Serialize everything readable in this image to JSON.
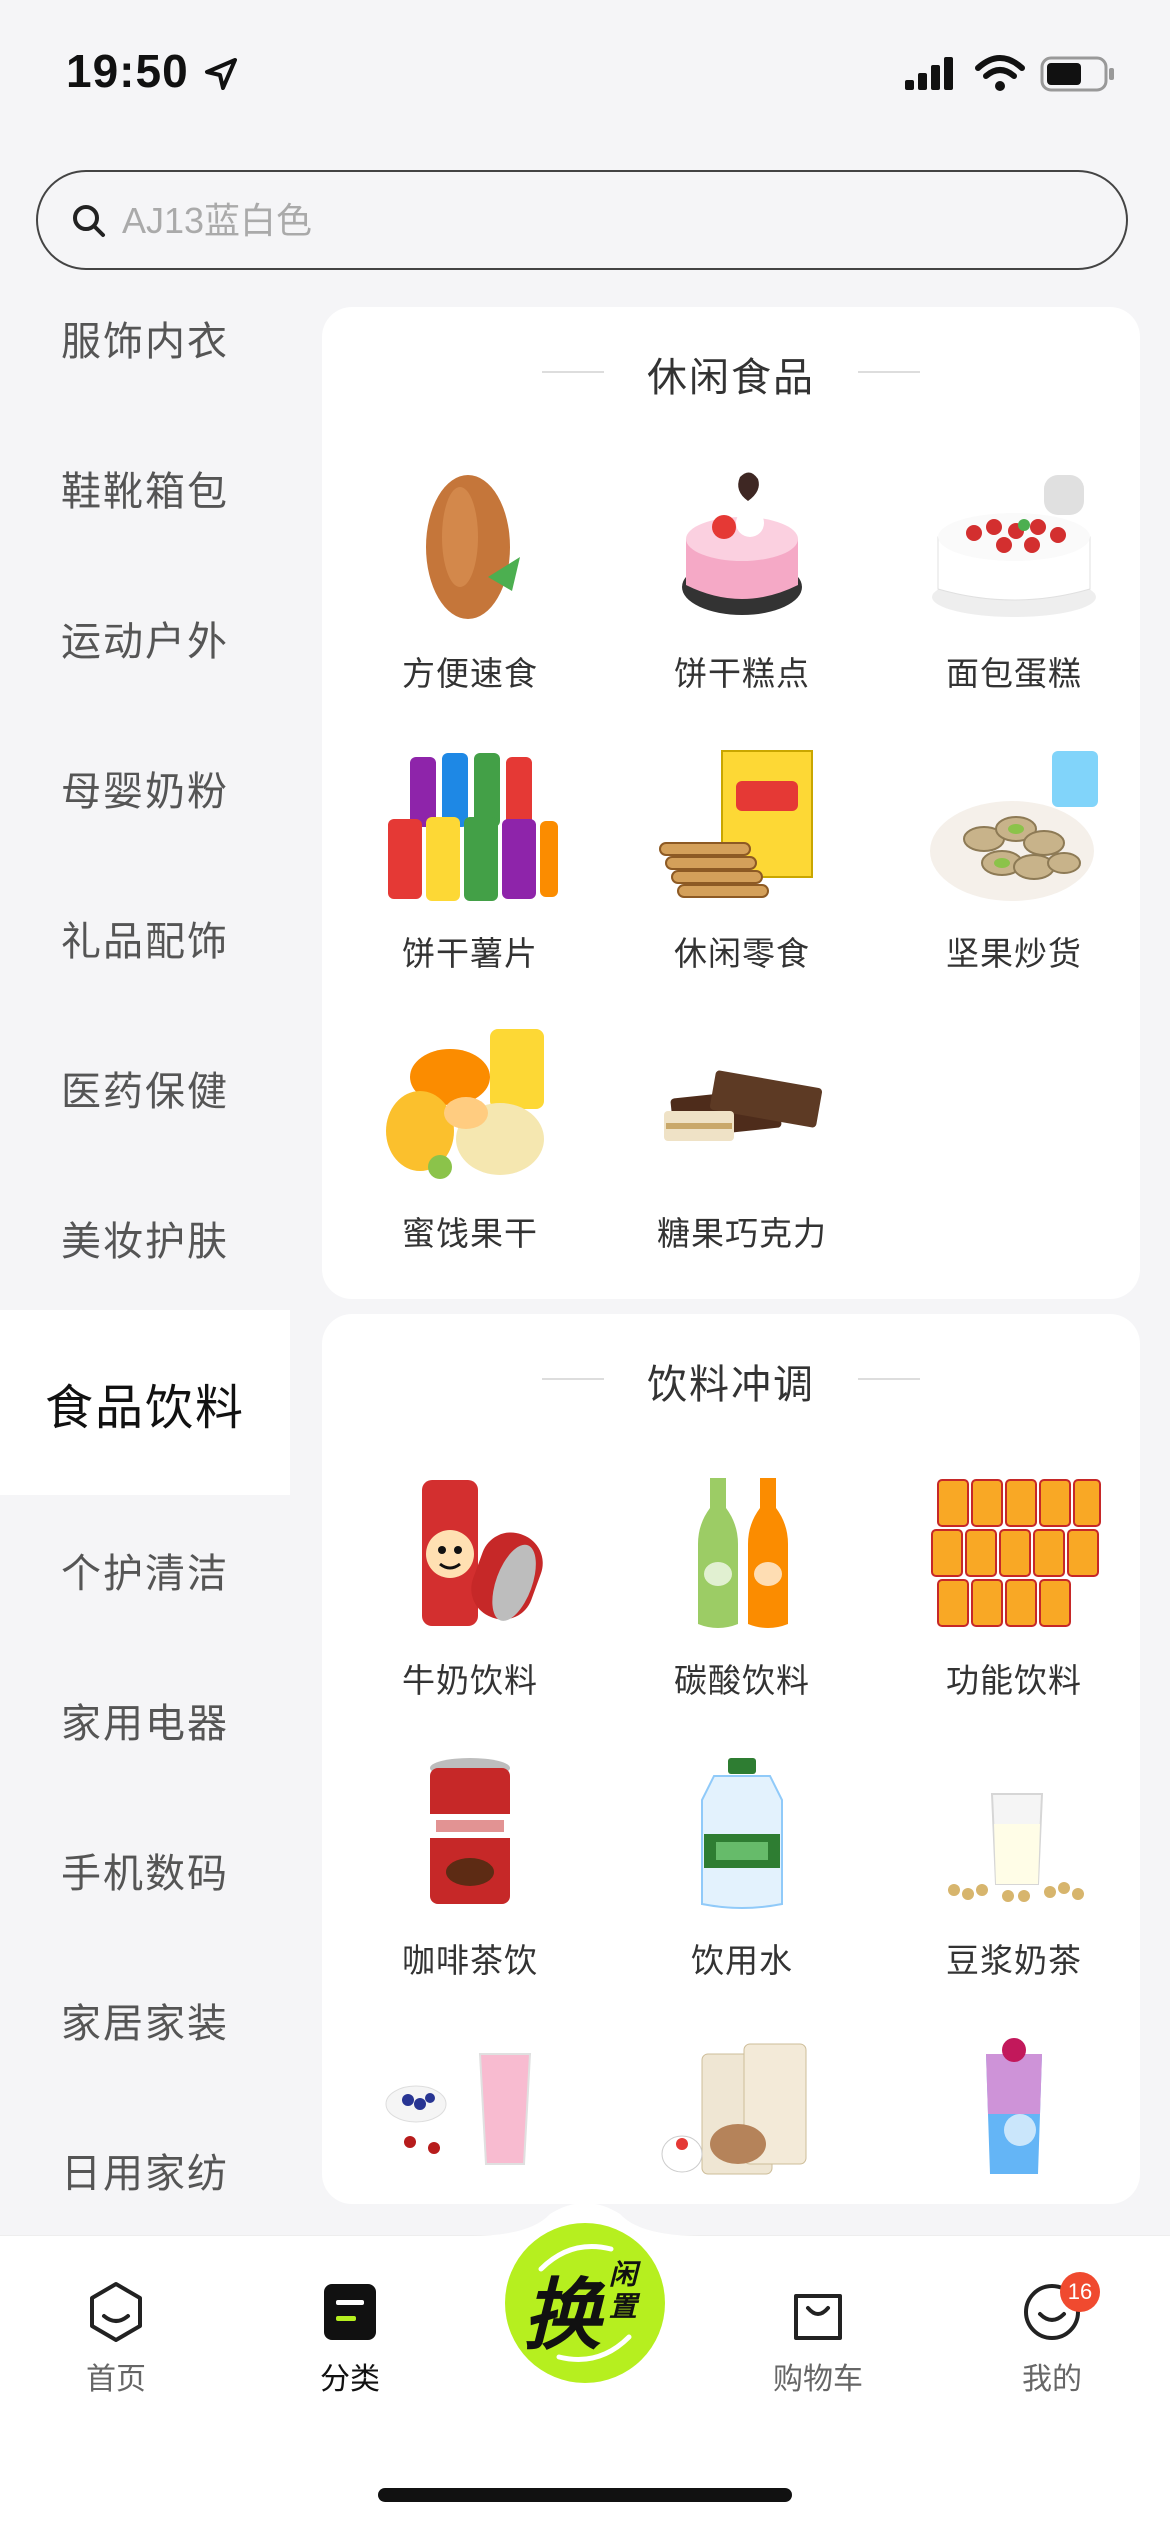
{
  "status_bar": {
    "time": "19:50"
  },
  "search": {
    "placeholder": "AJ13蓝白色"
  },
  "sidebar": {
    "items": [
      {
        "label": "服饰内衣"
      },
      {
        "label": "鞋靴箱包"
      },
      {
        "label": "运动户外"
      },
      {
        "label": "母婴奶粉"
      },
      {
        "label": "礼品配饰"
      },
      {
        "label": "医药保健"
      },
      {
        "label": "美妆护肤"
      },
      {
        "label": "食品饮料",
        "active": true
      },
      {
        "label": "个护清洁"
      },
      {
        "label": "家用电器"
      },
      {
        "label": "手机数码"
      },
      {
        "label": "家居家装"
      },
      {
        "label": "日用家纺"
      }
    ]
  },
  "sections": [
    {
      "title": "休闲食品",
      "items": [
        {
          "label": "方便速食",
          "icon": "almond-image"
        },
        {
          "label": "饼干糕点",
          "icon": "pink-cake-image"
        },
        {
          "label": "面包蛋糕",
          "icon": "strawberry-cake-image"
        },
        {
          "label": "饼干薯片",
          "icon": "chips-image"
        },
        {
          "label": "休闲零食",
          "icon": "rolls-snack-image"
        },
        {
          "label": "坚果炒货",
          "icon": "pistachio-image"
        },
        {
          "label": "蜜饯果干",
          "icon": "dried-fruit-image"
        },
        {
          "label": "糖果巧克力",
          "icon": "chocolate-image"
        }
      ]
    },
    {
      "title": "饮料冲调",
      "items": [
        {
          "label": "牛奶饮料",
          "icon": "milk-drink-can-image"
        },
        {
          "label": "碳酸饮料",
          "icon": "soda-bottle-image"
        },
        {
          "label": "功能饮料",
          "icon": "energy-drink-image"
        },
        {
          "label": "咖啡茶饮",
          "icon": "coffee-can-image"
        },
        {
          "label": "饮用水",
          "icon": "water-jug-image"
        },
        {
          "label": "豆浆奶茶",
          "icon": "soy-milk-image"
        },
        {
          "label": "",
          "icon": "berry-smoothie-image"
        },
        {
          "label": "",
          "icon": "cereal-bag-image"
        },
        {
          "label": "",
          "icon": "blue-drink-image"
        }
      ]
    }
  ],
  "tab_bar": {
    "tabs": [
      {
        "label": "首页",
        "icon": "home-hexagon-icon"
      },
      {
        "label": "分类",
        "icon": "category-icon",
        "active": true
      },
      {
        "label": "购物车",
        "icon": "shopping-bag-icon"
      },
      {
        "label": "我的",
        "icon": "profile-smile-icon"
      }
    ],
    "center": {
      "main": "换",
      "sub": "闲置"
    },
    "badge_count": "16"
  },
  "colors": {
    "accent": "#b6ef1f",
    "badge": "#f04a2f"
  }
}
